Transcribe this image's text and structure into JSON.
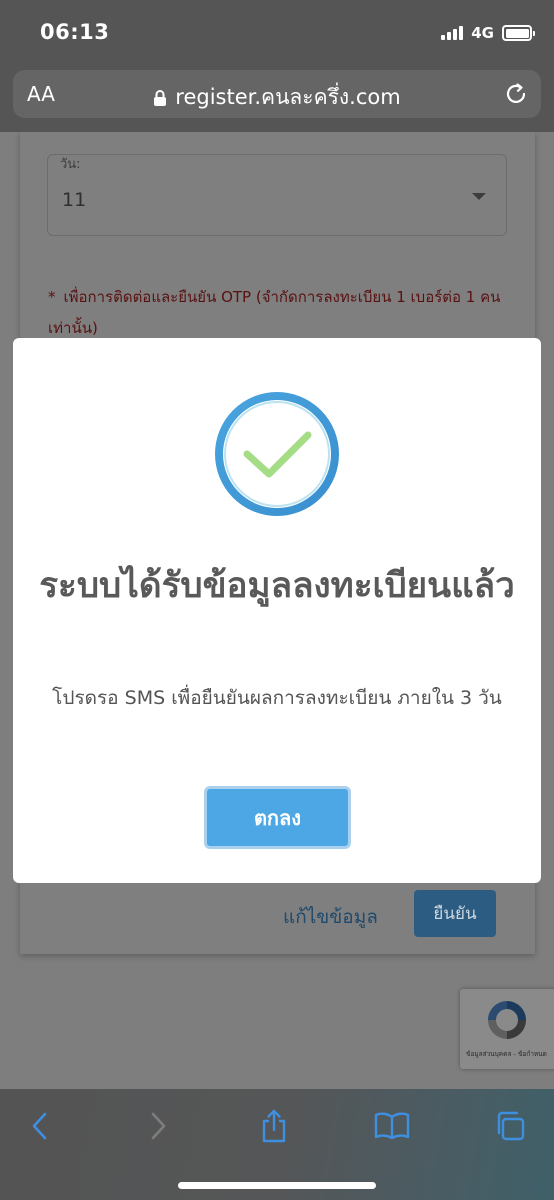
{
  "status_bar": {
    "time": "06:13",
    "network": "4G",
    "icons": [
      "signal-icon",
      "battery-icon"
    ]
  },
  "browser": {
    "text_size_label": "AA",
    "url": "register.คนละครึ่ง.com",
    "icons": [
      "lock-icon",
      "reload-icon"
    ]
  },
  "form": {
    "day_label": "วัน:",
    "day_value": "11",
    "note_marker": "*",
    "note_text": "เพื่อการติดต่อและยืนยัน OTP (จำกัดการลงทะเบียน 1 เบอร์ต่อ 1 คนเท่านั้น)",
    "edit_label": "แก้ไขข้อมูล",
    "confirm_label": "ยืนยัน"
  },
  "recaptcha": {
    "footer_text": "ข้อมูลส่วนบุคคล - ข้อกำหนด"
  },
  "modal": {
    "title": "ระบบได้รับข้อมูลลงทะเบียนแล้ว",
    "message": "โปรดรอ SMS เพื่อยืนยันผลการลงทะเบียน ภายใน 3 วัน",
    "ok_label": "ตกลง",
    "icon": "success-check-icon"
  },
  "toolbar": {
    "icons": [
      "back-icon",
      "forward-icon",
      "share-icon",
      "bookmarks-icon",
      "tabs-icon"
    ]
  },
  "colors": {
    "accent_blue": "#4ea7e5",
    "success_green": "#a5dc86",
    "ring_blue": "#3f9bd6",
    "error_red": "#5a1111"
  }
}
